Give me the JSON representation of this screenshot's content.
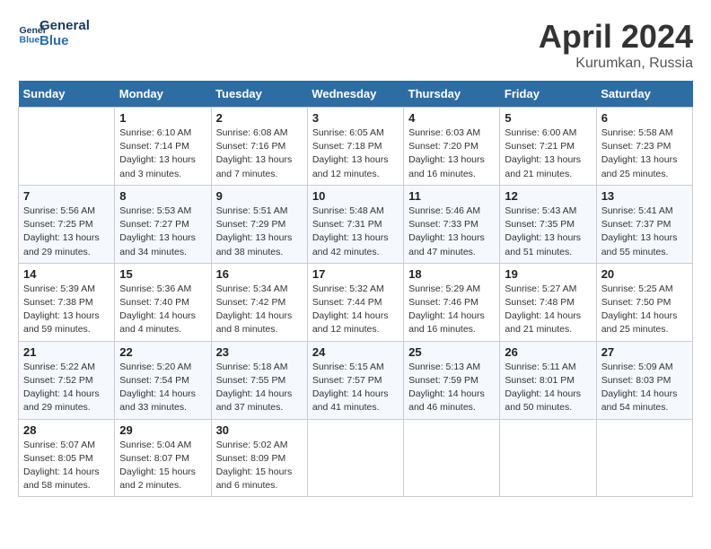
{
  "header": {
    "logo_line1": "General",
    "logo_line2": "Blue",
    "month_title": "April 2024",
    "location": "Kurumkan, Russia"
  },
  "weekdays": [
    "Sunday",
    "Monday",
    "Tuesday",
    "Wednesday",
    "Thursday",
    "Friday",
    "Saturday"
  ],
  "weeks": [
    [
      {
        "day": "",
        "info": ""
      },
      {
        "day": "1",
        "info": "Sunrise: 6:10 AM\nSunset: 7:14 PM\nDaylight: 13 hours\nand 3 minutes."
      },
      {
        "day": "2",
        "info": "Sunrise: 6:08 AM\nSunset: 7:16 PM\nDaylight: 13 hours\nand 7 minutes."
      },
      {
        "day": "3",
        "info": "Sunrise: 6:05 AM\nSunset: 7:18 PM\nDaylight: 13 hours\nand 12 minutes."
      },
      {
        "day": "4",
        "info": "Sunrise: 6:03 AM\nSunset: 7:20 PM\nDaylight: 13 hours\nand 16 minutes."
      },
      {
        "day": "5",
        "info": "Sunrise: 6:00 AM\nSunset: 7:21 PM\nDaylight: 13 hours\nand 21 minutes."
      },
      {
        "day": "6",
        "info": "Sunrise: 5:58 AM\nSunset: 7:23 PM\nDaylight: 13 hours\nand 25 minutes."
      }
    ],
    [
      {
        "day": "7",
        "info": "Sunrise: 5:56 AM\nSunset: 7:25 PM\nDaylight: 13 hours\nand 29 minutes."
      },
      {
        "day": "8",
        "info": "Sunrise: 5:53 AM\nSunset: 7:27 PM\nDaylight: 13 hours\nand 34 minutes."
      },
      {
        "day": "9",
        "info": "Sunrise: 5:51 AM\nSunset: 7:29 PM\nDaylight: 13 hours\nand 38 minutes."
      },
      {
        "day": "10",
        "info": "Sunrise: 5:48 AM\nSunset: 7:31 PM\nDaylight: 13 hours\nand 42 minutes."
      },
      {
        "day": "11",
        "info": "Sunrise: 5:46 AM\nSunset: 7:33 PM\nDaylight: 13 hours\nand 47 minutes."
      },
      {
        "day": "12",
        "info": "Sunrise: 5:43 AM\nSunset: 7:35 PM\nDaylight: 13 hours\nand 51 minutes."
      },
      {
        "day": "13",
        "info": "Sunrise: 5:41 AM\nSunset: 7:37 PM\nDaylight: 13 hours\nand 55 minutes."
      }
    ],
    [
      {
        "day": "14",
        "info": "Sunrise: 5:39 AM\nSunset: 7:38 PM\nDaylight: 13 hours\nand 59 minutes."
      },
      {
        "day": "15",
        "info": "Sunrise: 5:36 AM\nSunset: 7:40 PM\nDaylight: 14 hours\nand 4 minutes."
      },
      {
        "day": "16",
        "info": "Sunrise: 5:34 AM\nSunset: 7:42 PM\nDaylight: 14 hours\nand 8 minutes."
      },
      {
        "day": "17",
        "info": "Sunrise: 5:32 AM\nSunset: 7:44 PM\nDaylight: 14 hours\nand 12 minutes."
      },
      {
        "day": "18",
        "info": "Sunrise: 5:29 AM\nSunset: 7:46 PM\nDaylight: 14 hours\nand 16 minutes."
      },
      {
        "day": "19",
        "info": "Sunrise: 5:27 AM\nSunset: 7:48 PM\nDaylight: 14 hours\nand 21 minutes."
      },
      {
        "day": "20",
        "info": "Sunrise: 5:25 AM\nSunset: 7:50 PM\nDaylight: 14 hours\nand 25 minutes."
      }
    ],
    [
      {
        "day": "21",
        "info": "Sunrise: 5:22 AM\nSunset: 7:52 PM\nDaylight: 14 hours\nand 29 minutes."
      },
      {
        "day": "22",
        "info": "Sunrise: 5:20 AM\nSunset: 7:54 PM\nDaylight: 14 hours\nand 33 minutes."
      },
      {
        "day": "23",
        "info": "Sunrise: 5:18 AM\nSunset: 7:55 PM\nDaylight: 14 hours\nand 37 minutes."
      },
      {
        "day": "24",
        "info": "Sunrise: 5:15 AM\nSunset: 7:57 PM\nDaylight: 14 hours\nand 41 minutes."
      },
      {
        "day": "25",
        "info": "Sunrise: 5:13 AM\nSunset: 7:59 PM\nDaylight: 14 hours\nand 46 minutes."
      },
      {
        "day": "26",
        "info": "Sunrise: 5:11 AM\nSunset: 8:01 PM\nDaylight: 14 hours\nand 50 minutes."
      },
      {
        "day": "27",
        "info": "Sunrise: 5:09 AM\nSunset: 8:03 PM\nDaylight: 14 hours\nand 54 minutes."
      }
    ],
    [
      {
        "day": "28",
        "info": "Sunrise: 5:07 AM\nSunset: 8:05 PM\nDaylight: 14 hours\nand 58 minutes."
      },
      {
        "day": "29",
        "info": "Sunrise: 5:04 AM\nSunset: 8:07 PM\nDaylight: 15 hours\nand 2 minutes."
      },
      {
        "day": "30",
        "info": "Sunrise: 5:02 AM\nSunset: 8:09 PM\nDaylight: 15 hours\nand 6 minutes."
      },
      {
        "day": "",
        "info": ""
      },
      {
        "day": "",
        "info": ""
      },
      {
        "day": "",
        "info": ""
      },
      {
        "day": "",
        "info": ""
      }
    ]
  ]
}
